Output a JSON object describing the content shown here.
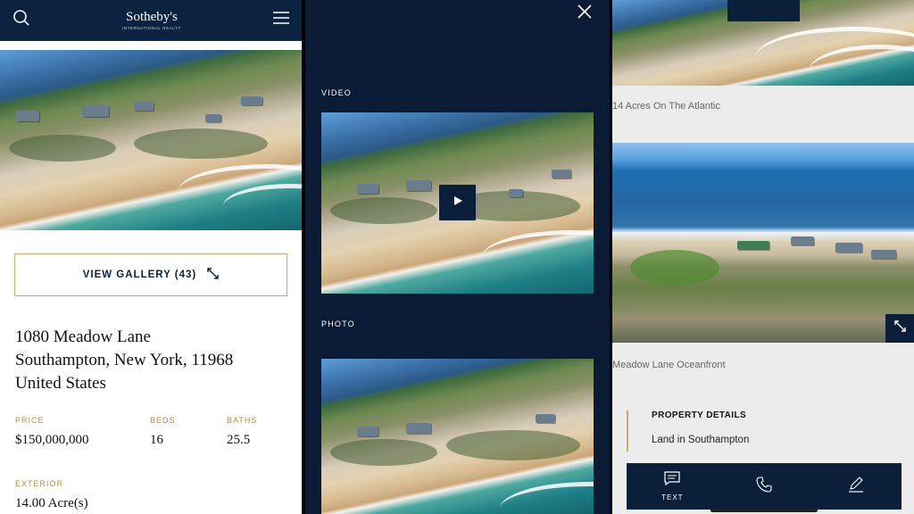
{
  "panel1": {
    "brand_name": "Sotheby's",
    "brand_sub": "INTERNATIONAL REALTY",
    "gallery_label": "VIEW GALLERY (43)",
    "address": [
      "1080 Meadow Lane",
      "Southampton, New York, 11968",
      "United States"
    ],
    "stats": [
      {
        "label": "PRICE",
        "value": "$150,000,000"
      },
      {
        "label": "BEDS",
        "value": "16"
      },
      {
        "label": "BATHS",
        "value": "25.5"
      },
      {
        "label": "EXTERIOR",
        "value": "14.00 Acre(s)"
      }
    ]
  },
  "panel2": {
    "video_label": "VIDEO",
    "photo_label": "PHOTO"
  },
  "panel3": {
    "caption1": "14 Acres On The Atlantic",
    "caption2": "Meadow Lane Oceanfront",
    "details_title": "PROPERTY DETAILS",
    "details_text": "Land in Southampton",
    "bottombar": {
      "text_label": "TEXT"
    }
  },
  "icons": {
    "search": "search-icon",
    "menu": "hamburger-menu-icon",
    "expand": "expand-arrows-icon",
    "close": "close-icon",
    "play": "play-icon",
    "text": "chat-text-icon",
    "phone": "phone-icon",
    "edit": "pencil-edit-icon"
  },
  "colors": {
    "navy": "#0b2240",
    "gold": "#c9a86b",
    "gold_label": "#b78b3f"
  }
}
